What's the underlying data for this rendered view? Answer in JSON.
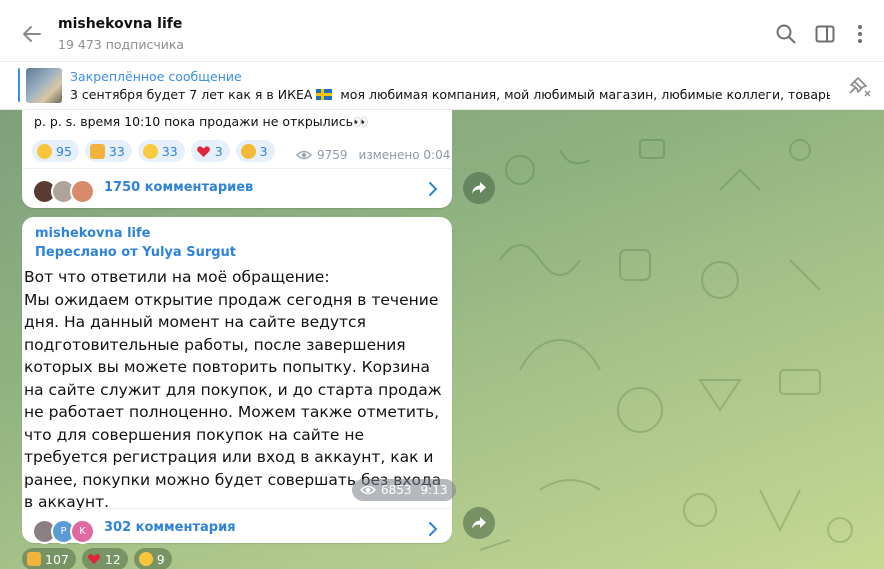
{
  "header": {
    "channel_name": "mishekovna life",
    "subscribers": "19 473 подписчика",
    "icons": [
      "back-arrow-icon",
      "search-icon",
      "sidebar-toggle-icon",
      "more-vertical-icon"
    ]
  },
  "pinned": {
    "title": "Закреплённое сообщение",
    "text_before_flag": "3 сентября будет 7 лет как я в ИКЕА",
    "text_after_flag": " моя любимая компания, мой любимый магазин, любимые коллеги, товары, ин...",
    "flag": "swedish-flag-emoji",
    "unpin_icon": "unpin-icon"
  },
  "message1": {
    "text_tail": "p. p. s. время 10:10 пока продажи не открылись👀",
    "reactions": [
      {
        "icon": "sad-face-emoji",
        "count": "95"
      },
      {
        "icon": "thumbs-up-emoji",
        "count": "33"
      },
      {
        "icon": "grinning-face-emoji",
        "count": "33"
      },
      {
        "icon": "red-heart-emoji",
        "count": "3"
      },
      {
        "icon": "face-with-hearts-emoji",
        "count": "3"
      }
    ],
    "views": "9759",
    "edited_time": "изменено 0:04",
    "comments": "1750 комментариев"
  },
  "message2": {
    "channel": "mishekovna life",
    "forwarded": "Переслано от Yulya Surgut",
    "text": "Вот что ответили на моё обращение:\nМы ожидаем открытие продаж сегодня в течение дня. На данный момент на сайте ведутся подготовительные работы, после завершения которых вы можете повторить попытку. Корзина на сайте служит для покупок, и до старта продаж не работает полноценно. Можем также отметить, что для совершения покупок на сайте не требуется регистрация или вход в аккаунт, как и ранее, покупки можно будет совершать без входа в аккаунт.",
    "views": "6853",
    "time": "9:13",
    "comment_avatars": [
      "",
      "P",
      "K"
    ],
    "comments": "302 комментария"
  },
  "message3": {
    "reactions": [
      {
        "icon": "thumbs-up-emoji",
        "count": "107"
      },
      {
        "icon": "red-heart-emoji",
        "count": "12"
      },
      {
        "icon": "sad-face-emoji",
        "count": "9"
      }
    ]
  },
  "colors": {
    "accent": "#2e83d9",
    "reaction_bg": "#e6f0fb",
    "chat_bg_start": "#7fa07c",
    "chat_bg_end": "#c7d893"
  }
}
